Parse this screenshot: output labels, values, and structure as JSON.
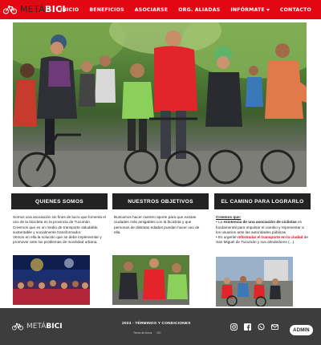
{
  "brand": {
    "part1": "METÁ",
    "part2": "BICI"
  },
  "nav": {
    "items": [
      {
        "label": "INICIO"
      },
      {
        "label": "BENEFICIOS"
      },
      {
        "label": "ASOCIARSE"
      },
      {
        "label": "ORG. ALIADAS"
      },
      {
        "label": "INFÓRMATE"
      },
      {
        "label": "CONTACTO"
      }
    ]
  },
  "colors": {
    "accent": "#e30613",
    "header_bar": "#222222",
    "footer": "#3d3d3d"
  },
  "sections": {
    "quienes": {
      "title": "QUIENES SOMOS",
      "p1": "Somos una asociación sin fines de lucro que fomenta el uso de la bicicleta en la provincia de Tucumán. Creemos que es un medio de transporte saludable, sustentable y socialmente transformador.",
      "p2": "Vemos en ella la solución que se debe implementar y promover ante los problemas de movilidad urbana."
    },
    "objetivos": {
      "title": "NUESTROS OBJETIVOS",
      "p1": "Buscamos hacer nuestro aporte para que existan ciudades más amigables con la bicicleta y que personas de distintas edades puedan hacer uso de ella."
    },
    "camino": {
      "title": "EL CAMINO PARA LOGRARLO",
      "lead": "Creemos que:",
      "b1_pre": "La ",
      "b1_em": "existencia de una asociación de ciclistas",
      "b1_post": " es fundamental para impulsar el cambio y representar a los usuarios ante las autoridades públicas.",
      "b2_pre": "Es urgente ",
      "b2_em": "reformular el transporte en la ciudad",
      "b2_post": " de San Miguel de Tucumán y sus alrededores (...)"
    }
  },
  "footer": {
    "copyright": "2023 - TÉRMINOS Y CONDICIONES",
    "sponsors": [
      "Tierra de Anos",
      "OC"
    ],
    "admin_label": "ADMIN",
    "social_icons": [
      "instagram-icon",
      "facebook-icon",
      "whatsapp-icon",
      "email-icon"
    ]
  }
}
